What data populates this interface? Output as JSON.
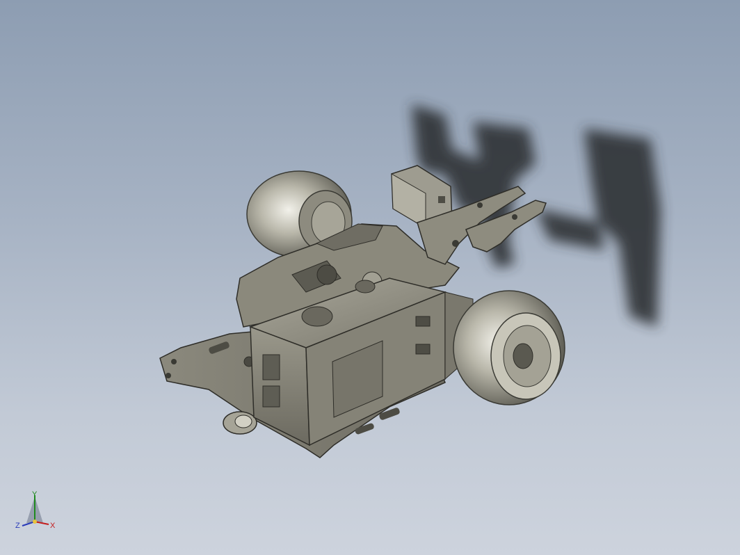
{
  "viewport": {
    "background_top": "#8d9db2",
    "background_bottom": "#cdd3dd",
    "model_body_color": "#8e8c7e",
    "model_shadow_color": "#2f3236"
  },
  "triad": {
    "labels": {
      "y": "Y",
      "z": "Z",
      "x": "X"
    },
    "colors": {
      "x": "#c41d1d",
      "y": "#1f8a1f",
      "z": "#2a3bb8"
    }
  }
}
